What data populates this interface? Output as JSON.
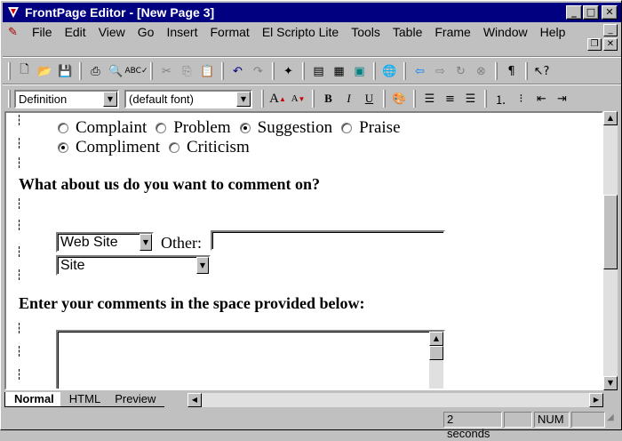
{
  "window": {
    "title": "FrontPage Editor - [New Page 3]"
  },
  "menu": [
    "File",
    "Edit",
    "View",
    "Go",
    "Insert",
    "Format",
    "El Scripto Lite",
    "Tools",
    "Table",
    "Frame",
    "Window",
    "Help"
  ],
  "format_toolbar": {
    "style_value": "Definition",
    "font_value": "(default font)"
  },
  "document": {
    "radio_row1": [
      {
        "label": "Complaint",
        "checked": false
      },
      {
        "label": "Problem",
        "checked": false
      },
      {
        "label": "Suggestion",
        "checked": true
      },
      {
        "label": "Praise",
        "checked": false
      }
    ],
    "radio_row2": [
      {
        "label": "Compliment",
        "checked": true
      },
      {
        "label": "Criticism",
        "checked": false
      }
    ],
    "question1": "What about us do you want to comment on?",
    "subject_select": "Web Site",
    "other_label": "Other:",
    "other_value": "",
    "site_select": "Site",
    "question2": "Enter your comments in the space provided below:"
  },
  "view_tabs": [
    "Normal",
    "HTML",
    "Preview"
  ],
  "status": {
    "time": "2 seconds",
    "num": "NUM"
  }
}
